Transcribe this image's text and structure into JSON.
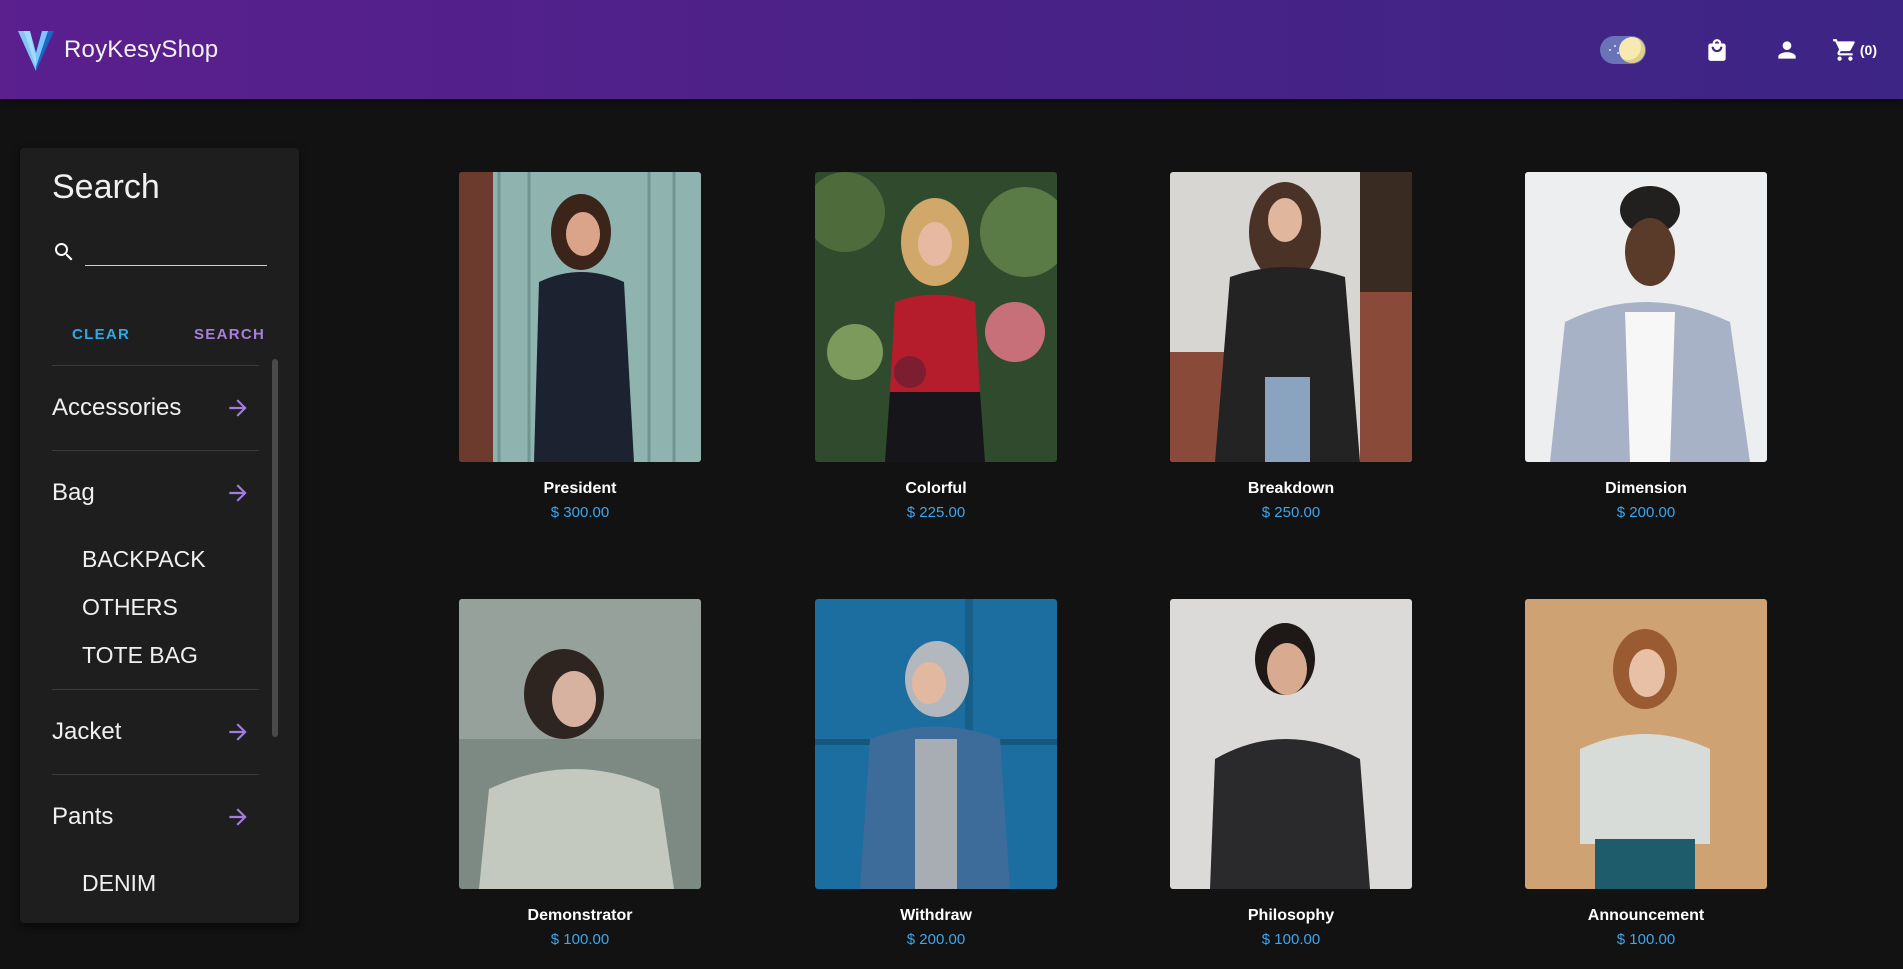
{
  "header": {
    "brand_name": "RoyKesyShop",
    "cart_count": "(0)",
    "icons": [
      "theme-toggle",
      "shopping-bag-icon",
      "account-icon",
      "cart-icon"
    ]
  },
  "sidebar": {
    "title": "Search",
    "search_placeholder": "",
    "clear_label": "CLEAR",
    "search_label": "SEARCH",
    "categories": [
      {
        "label": "Accessories",
        "subs": []
      },
      {
        "label": "Bag",
        "subs": [
          "BACKPACK",
          "OTHERS",
          "TOTE BAG"
        ]
      },
      {
        "label": "Jacket",
        "subs": []
      },
      {
        "label": "Pants",
        "subs": [
          "DENIM"
        ]
      }
    ]
  },
  "products": [
    {
      "name": "President",
      "price": "$ 300.00"
    },
    {
      "name": "Colorful",
      "price": "$ 225.00"
    },
    {
      "name": "Breakdown",
      "price": "$ 250.00"
    },
    {
      "name": "Dimension",
      "price": "$ 200.00"
    },
    {
      "name": "Demonstrator",
      "price": "$ 100.00"
    },
    {
      "name": "Withdraw",
      "price": "$ 200.00"
    },
    {
      "name": "Philosophy",
      "price": "$ 100.00"
    },
    {
      "name": "Announcement",
      "price": "$ 100.00"
    }
  ],
  "colors": {
    "header_gradient_start": "#5b1f8e",
    "header_gradient_end": "#3d2585",
    "price_blue": "#3ea6ee",
    "clear_blue": "#2ea8e8",
    "accent_purple": "#a27ce0",
    "background": "#121212"
  }
}
